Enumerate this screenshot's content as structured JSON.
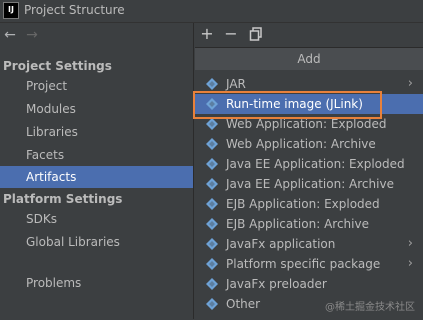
{
  "window": {
    "logo": "IJ",
    "title": "Project Structure"
  },
  "nav": {
    "back_icon": "arrow-left-icon",
    "forward_icon": "arrow-right-icon",
    "project_settings": "Project Settings",
    "project_items": [
      "Project",
      "Modules",
      "Libraries",
      "Facets",
      "Artifacts"
    ],
    "selected": "Artifacts",
    "platform_settings": "Platform Settings",
    "platform_items": [
      "SDKs",
      "Global Libraries"
    ],
    "problems": "Problems"
  },
  "toolbar": {
    "add": "+",
    "remove": "−",
    "copy_icon": "copy-icon"
  },
  "popup": {
    "header": "Add",
    "items": [
      {
        "label": "JAR",
        "submenu": true
      },
      {
        "label": "Run-time image (JLink)",
        "submenu": false,
        "selected": true
      },
      {
        "label": "Web Application: Exploded",
        "submenu": false
      },
      {
        "label": "Web Application: Archive",
        "submenu": false
      },
      {
        "label": "Java EE Application: Exploded",
        "submenu": false
      },
      {
        "label": "Java EE Application: Archive",
        "submenu": false
      },
      {
        "label": "EJB Application: Exploded",
        "submenu": false
      },
      {
        "label": "EJB Application: Archive",
        "submenu": false
      },
      {
        "label": "JavaFx application",
        "submenu": true
      },
      {
        "label": "Platform specific package",
        "submenu": true
      },
      {
        "label": "JavaFx preloader",
        "submenu": false
      },
      {
        "label": "Other",
        "submenu": false
      }
    ]
  },
  "colors": {
    "accent": "#4b6eaf",
    "highlight_border": "#e8813b",
    "icon_blue": "#6ea2d6"
  },
  "watermark": "@稀土掘金技术社区"
}
